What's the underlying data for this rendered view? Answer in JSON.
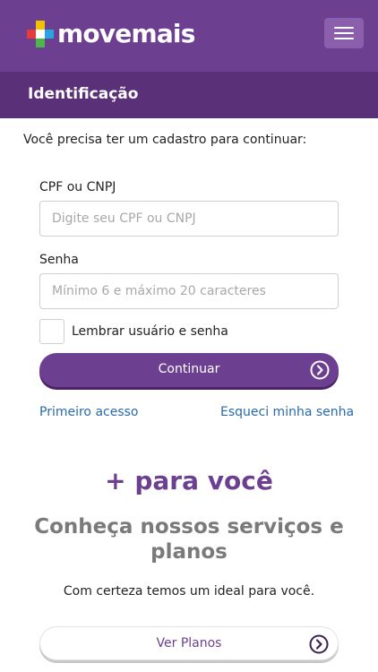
{
  "header": {
    "logo_text": "movemais",
    "menu_icon": "hamburger-menu-icon",
    "bg_color": "#6d3f91"
  },
  "subheader": {
    "title": "Identificação"
  },
  "login": {
    "intro": "Você precisa ter um cadastro para continuar:",
    "cpf_label": "CPF ou CNPJ",
    "cpf_value": "",
    "cpf_placeholder": "Digite seu CPF ou CNPJ",
    "senha_label": "Senha",
    "senha_value": "",
    "senha_placeholder": "Mínimo 6 e máximo 20 caracteres",
    "remember_label": "Lembrar usuário e senha",
    "remember_checked": false,
    "continue_label": "Continuar",
    "continue_icon": "arrow-right-circle-icon",
    "first_access_link": "Primeiro acesso",
    "forgot_password_link": "Esqueci minha senha"
  },
  "promo": {
    "title": "+ para você",
    "subtitle": "Conheça nossos serviços e planos",
    "text": "Com certeza temos um ideal para você.",
    "plans_button_label": "Ver Planos",
    "plans_button_icon": "arrow-right-circle-icon"
  },
  "colors": {
    "brand_purple": "#6d3f91",
    "subheader_purple": "#5a3078",
    "link_blue": "#2a6aa8"
  }
}
